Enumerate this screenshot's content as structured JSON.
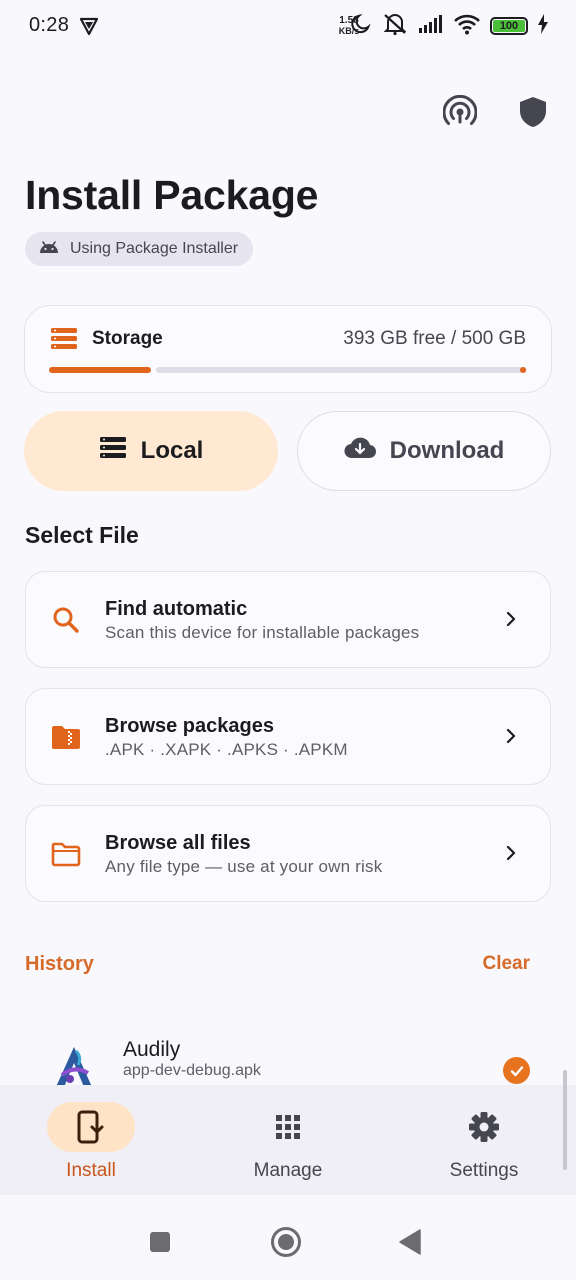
{
  "status_bar": {
    "time": "0:28",
    "net_speed_value": "1.58",
    "net_speed_unit": "KB/s",
    "battery": "100"
  },
  "header": {
    "title": "Install Package",
    "installer_chip": "Using Package Installer"
  },
  "storage": {
    "label": "Storage",
    "value": "393 GB free / 500 GB",
    "used_fraction": 0.214,
    "accent": "#e1641c"
  },
  "source_tabs": {
    "local": "Local",
    "download": "Download",
    "selected": "local"
  },
  "select_file": {
    "title": "Select File",
    "options": [
      {
        "title": "Find automatic",
        "subtitle": "Scan this device for installable packages",
        "icon": "search-icon"
      },
      {
        "title": "Browse packages",
        "subtitle": ".APK · .XAPK · .APKS · .APKM",
        "icon": "package-folder-icon"
      },
      {
        "title": "Browse all files",
        "subtitle": "Any file type — use at your own risk",
        "icon": "folder-icon"
      }
    ]
  },
  "history": {
    "title": "History",
    "clear": "Clear",
    "items": [
      {
        "name": "Audily",
        "file": "app-dev-debug.apk",
        "status": "installed"
      }
    ]
  },
  "bottom_nav": {
    "items": [
      {
        "label": "Install",
        "icon": "install-phone-icon",
        "active": true
      },
      {
        "label": "Manage",
        "icon": "grid-icon",
        "active": false
      },
      {
        "label": "Settings",
        "icon": "gear-icon",
        "active": false
      }
    ]
  },
  "colors": {
    "accent": "#d66a2b",
    "accent_container": "#ffe9d2"
  }
}
